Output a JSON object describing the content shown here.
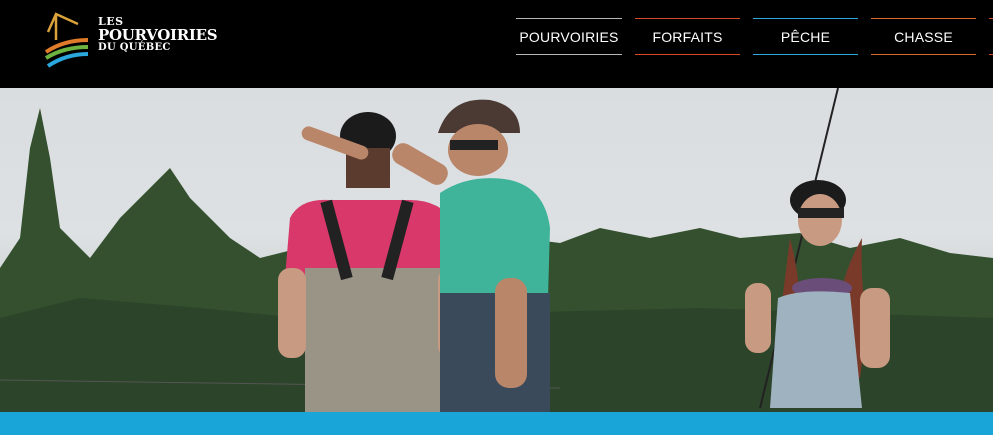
{
  "logo": {
    "line1": "LES",
    "line2": "POURVOIRIES",
    "line3": "DU QUÉBEC"
  },
  "nav": {
    "items": [
      {
        "label": "POURVOIRIES",
        "color": "#b8b8b8"
      },
      {
        "label": "FORFAITS",
        "color": "#d94a2b"
      },
      {
        "label": "PÊCHE",
        "color": "#2aa7dc"
      },
      {
        "label": "CHASSE",
        "color": "#d96a2b"
      }
    ]
  },
  "colors": {
    "accent_bar": "#1aa5d8",
    "header_bg": "#000000"
  }
}
